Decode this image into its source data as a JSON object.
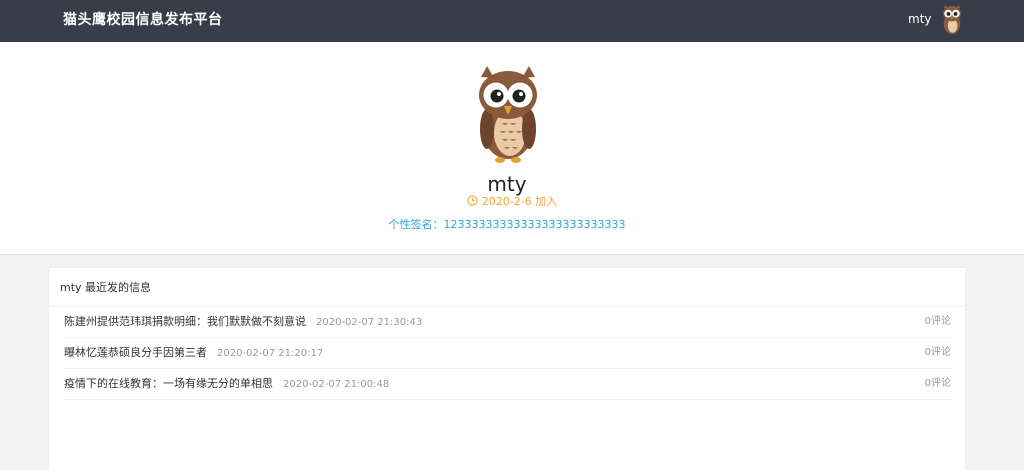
{
  "header": {
    "brand": "猫头鹰校园信息发布平台",
    "username": "mty"
  },
  "profile": {
    "name": "mty",
    "joined": "2020-2-6 加入",
    "signature": "个性签名：12333333333333333333333333",
    "joined_color": "#f0a030",
    "signature_color": "#29a3d8"
  },
  "recent": {
    "title": "mty 最近发的信息",
    "items": [
      {
        "title": "陈建州提供范玮琪捐款明细：我们默默做不刻意说",
        "time": "2020-02-07 21:30:43",
        "comments": "0评论"
      },
      {
        "title": "曝林忆莲恭硕良分手因第三者",
        "time": "2020-02-07 21:20:17",
        "comments": "0评论"
      },
      {
        "title": "疫情下的在线教育：一场有缘无分的单相思",
        "time": "2020-02-07 21:00:48",
        "comments": "0评论"
      }
    ]
  },
  "colors": {
    "topbar": "#393d49",
    "owl_body": "#8a5a3c",
    "owl_belly": "#e8c9a8"
  },
  "icons": {
    "nav_avatar": "owl-avatar-icon",
    "profile_avatar": "owl-avatar-icon",
    "joined": "clock-icon"
  }
}
